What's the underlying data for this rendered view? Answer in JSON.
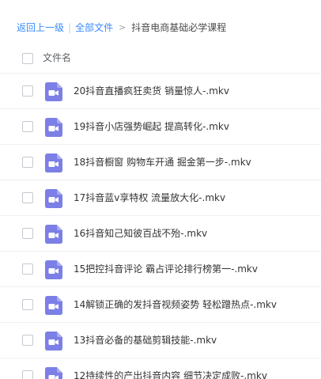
{
  "breadcrumb": {
    "back_label": "返回上一级",
    "separator": "|",
    "all_files_label": "全部文件",
    "arrow": ">",
    "current_folder": "抖音电商基础必学课程"
  },
  "header": {
    "name_column": "文件名"
  },
  "colors": {
    "accent_link": "#3b8cff",
    "video_icon": "#7b7fe6"
  },
  "files": [
    {
      "name": "20抖音直播疯狂卖货 销量惊人-.mkv",
      "icon": "video-file-icon"
    },
    {
      "name": "19抖音小店强势崛起 提高转化-.mkv",
      "icon": "video-file-icon"
    },
    {
      "name": "18抖音橱窗 购物车开通 掘金第一步-.mkv",
      "icon": "video-file-icon"
    },
    {
      "name": "17抖音蓝v享特权 流量放大化-.mkv",
      "icon": "video-file-icon"
    },
    {
      "name": "16抖音知己知彼百战不殆-.mkv",
      "icon": "video-file-icon"
    },
    {
      "name": "15把控抖音评论 霸占评论排行榜第一-.mkv",
      "icon": "video-file-icon"
    },
    {
      "name": "14解锁正确的发抖音视频姿势 轻松蹭热点-.mkv",
      "icon": "video-file-icon"
    },
    {
      "name": "13抖音必备的基础剪辑技能-.mkv",
      "icon": "video-file-icon"
    },
    {
      "name": "12持续性的产出抖音内容 细节决定成败-.mkv",
      "icon": "video-file-icon"
    }
  ]
}
